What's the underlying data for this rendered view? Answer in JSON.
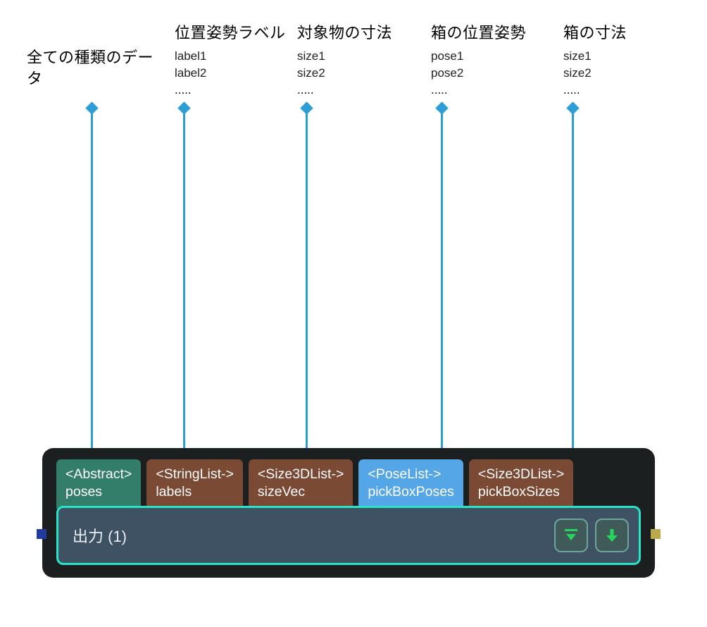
{
  "colors": {
    "connector": "#2d9dd6",
    "node_outer": "#1b1f1f",
    "node_body": "#3f5263",
    "node_border": "#27e3c8",
    "port_teal": "#337e6b",
    "port_brown": "#7a4a35",
    "port_blue": "#54a6e6",
    "icon_glyph": "#26d65a",
    "stud_left": "#203a9e",
    "stud_right": "#bca949"
  },
  "annotations": [
    {
      "title": "全ての種類のデータ",
      "sub_lines": [],
      "ellipsis": ""
    },
    {
      "title": "位置姿勢ラベル",
      "sub_lines": [
        "label1",
        "label2"
      ],
      "ellipsis": "....."
    },
    {
      "title": "対象物の寸法",
      "sub_lines": [
        "size1",
        "size2"
      ],
      "ellipsis": "....."
    },
    {
      "title": "箱の位置姿勢",
      "sub_lines": [
        "pose1",
        "pose2"
      ],
      "ellipsis": "....."
    },
    {
      "title": "箱の寸法",
      "sub_lines": [
        "size1",
        "size2"
      ],
      "ellipsis": "....."
    }
  ],
  "ports": [
    {
      "type": "<Abstract>",
      "name": "poses",
      "color": "teal"
    },
    {
      "type": "<StringList->",
      "name": "labels",
      "color": "brown"
    },
    {
      "type": "<Size3DList->",
      "name": "sizeVec",
      "color": "brown"
    },
    {
      "type": "<PoseList->",
      "name": "pickBoxPoses",
      "color": "blue"
    },
    {
      "type": "<Size3DList->",
      "name": "pickBoxSizes",
      "color": "brown"
    }
  ],
  "node": {
    "title": "出力 (1)",
    "buttons": [
      {
        "icon": "expand-down"
      },
      {
        "icon": "arrow-down"
      }
    ]
  }
}
